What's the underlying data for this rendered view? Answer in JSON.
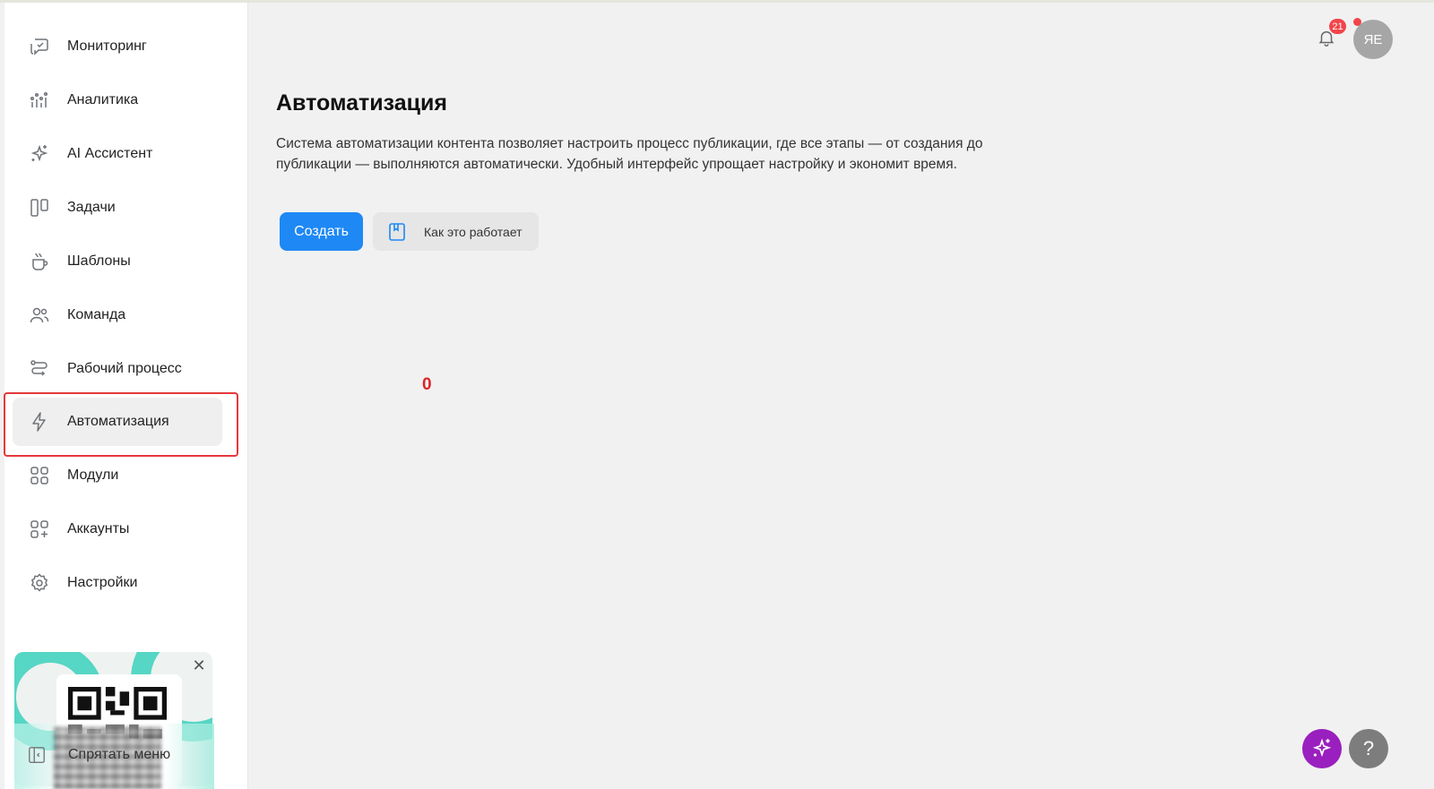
{
  "sidebar": {
    "items": [
      {
        "label": "Мониторинг",
        "icon": "monitoring-icon"
      },
      {
        "label": "Аналитика",
        "icon": "analytics-icon"
      },
      {
        "label": "AI Ассистент",
        "icon": "sparkles-icon"
      },
      {
        "label": "Задачи",
        "icon": "kanban-icon"
      },
      {
        "label": "Шаблоны",
        "icon": "templates-icon"
      },
      {
        "label": "Команда",
        "icon": "team-icon"
      },
      {
        "label": "Рабочий процесс",
        "icon": "workflow-icon"
      },
      {
        "label": "Автоматизация",
        "icon": "lightning-icon",
        "active": true
      },
      {
        "label": "Модули",
        "icon": "modules-icon"
      },
      {
        "label": "Аккаунты",
        "icon": "accounts-icon"
      },
      {
        "label": "Настройки",
        "icon": "gear-icon"
      }
    ],
    "hide_menu_label": "Спрятать меню"
  },
  "main": {
    "title": "Автоматизация",
    "description": "Система автоматизации контента позволяет настроить процесс публикации, где все этапы — от создания до публикации — выполняются автоматически. Удобный интерфейс упрощает настройку и экономит время.",
    "create_button": "Создать",
    "how_it_works_button": "Как это работает",
    "annotation": "0"
  },
  "header": {
    "notifications_count": "21",
    "avatar_initials": "ЯЕ"
  },
  "colors": {
    "accent": "#1e88f5",
    "highlight_box": "#e5393b",
    "badge": "#f2454b",
    "ai_button": "#9a1fbf",
    "promo_ring": "#56d6c4"
  }
}
